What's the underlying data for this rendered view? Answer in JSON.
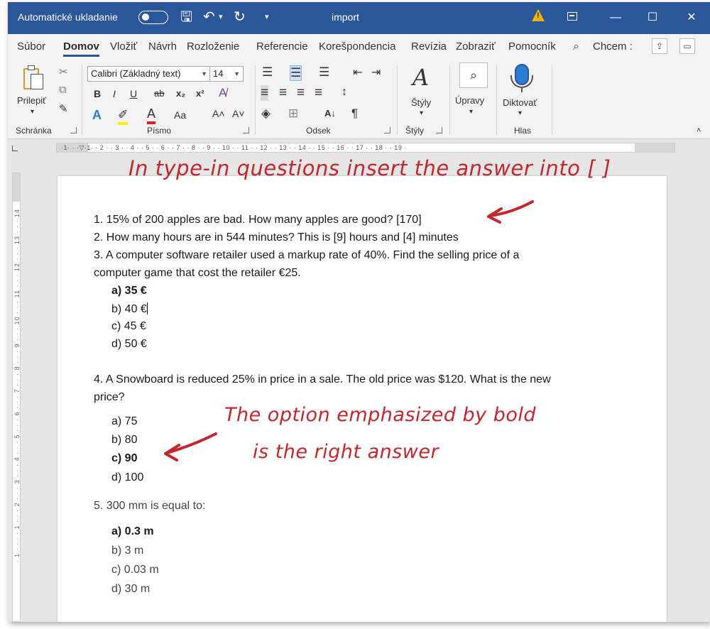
{
  "titlebar": {
    "autosave_label": "Automatické ukladanie",
    "doc_title": "import",
    "save_glyph": "🖫",
    "undo_glyph": "↶",
    "undo_dd_glyph": "▾",
    "redo_glyph": "↻",
    "qat_glyph": "▾",
    "warning_glyph": "!",
    "minimize_glyph": "—",
    "maximize_glyph": "☐",
    "close_glyph": "✕"
  },
  "menu": {
    "tabs": [
      "Súbor",
      "Domov",
      "Vložiť",
      "Návrh",
      "Rozloženie",
      "Referencie",
      "Korešpondencia",
      "Revízia",
      "Zobraziť",
      "Pomocník"
    ],
    "active_tab": "Domov",
    "search_text": "Chcem :",
    "search_glyph": "⌕",
    "share_glyph": "⇪",
    "comment_glyph": "▭"
  },
  "ribbon": {
    "clipboard": {
      "paste_label": "Prilepiť",
      "paste_dd": "▾",
      "cut_glyph": "✂",
      "copy_glyph": "⧉",
      "painter_glyph": "✎",
      "group_label": "Schránka"
    },
    "font": {
      "font_name": "Calibri (Základný text)",
      "font_size": "14",
      "bold": "B",
      "italic": "I",
      "underline": "U",
      "strike": "ab",
      "subscript": "x₂",
      "superscript": "x²",
      "clear_glyph": "A̸",
      "effects_glyph": "A",
      "highlight_glyph": "✐",
      "color_glyph": "A",
      "case_label": "Aa",
      "grow_label": "A˄",
      "shrink_label": "A˅",
      "group_label": "Písmo"
    },
    "paragraph": {
      "bullets_glyph": "☰",
      "numbering_glyph": "☰",
      "multilevel_glyph": "☰",
      "decrease_indent_glyph": "⇤",
      "increase_indent_glyph": "⇥",
      "align_glyphs": [
        "≡",
        "≡",
        "≡",
        "≡"
      ],
      "spacing_glyph": "↕",
      "shading_glyph": "◈",
      "borders_glyph": "⊞",
      "sort_glyph": "A↓",
      "pilcrow_glyph": "¶",
      "group_label": "Odsek"
    },
    "styles": {
      "styles_label": "Štýly",
      "glyph": "A",
      "group_label": "Štýly"
    },
    "editing": {
      "label": "Úpravy",
      "glyph": "⌕"
    },
    "voice": {
      "label": "Diktovať",
      "group_label": "Hlas"
    }
  },
  "ruler": {
    "numbers": "·1· ·  ·▽·1· · 2 · · 3 · · 4 · · 5 · · 6 · · 7 · · 8 · · 9 · · 10 · · 11 · · 12 · · 13 · · 14 · · 15 · · 16 · · 17 · · 18 · · 19 ·",
    "corner": "∟",
    "vertical_numbers": "· 1 · · · · 1 · · · 2 · · · 3 · · · 4 · · · 5 · · · 6 · · · 7 · · · 8 · · · 9 · · · 10 · · · 11 · · · 12 · · · 13 · · · 14"
  },
  "document": {
    "q1": "1. 15% of 200 apples are bad. How many apples are good?  [170]",
    "q2": "2. How many hours are in 544 minutes?  This is [9] hours and [4] minutes",
    "q3_line1": "3. A computer software retailer used a markup rate of 40%. Find the selling price of a",
    "q3_line2": "computer game that cost the retailer €25.",
    "q3_options": [
      "a)  35 €",
      "b)  40 €",
      "c)  45 €",
      "d)  50 €"
    ],
    "q4_line1": "4. A Snowboard is reduced 25% in price in a sale. The old price was $120. What is the new",
    "q4_line2": "price?",
    "q4_options": [
      "a)  75",
      "b)  80",
      "c)  90",
      "d)  100"
    ],
    "q5": "5. 300 mm is equal to:",
    "q5_options": [
      "a)  0.3 m",
      "b)  3 m",
      "c)  0.03 m",
      "d)  30 m"
    ]
  },
  "annotations": {
    "top": "In type-in questions insert the answer into [ ]",
    "mid_line1": "The option emphasized by bold",
    "mid_line2": "is the right answer",
    "color": "#c0282d"
  },
  "colors": {
    "accent": "#2b579a",
    "warning": "#f7b500"
  }
}
